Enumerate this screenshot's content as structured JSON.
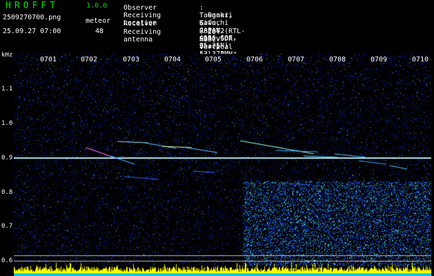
{
  "app": {
    "name": "HROFFT",
    "version": "1.0.0"
  },
  "file_name": "2509270700.png",
  "datetime": "25.09.27 07:00",
  "meteor": {
    "label": "meteor",
    "count": "48"
  },
  "info": [
    {
      "key": "Observer",
      "value": ": Takanori Kawachi"
    },
    {
      "key": "Receiving Location",
      "value": ": Ogaki, Gifu, JAPAN (136.60E, 35.35N)"
    },
    {
      "key": "Receiver",
      "value": ": R820T2(RTL-SDR) SDR-Sharp 53.372MHz"
    },
    {
      "key": "Receiving antenna",
      "value": ": 2el-HB9CV Vertical (el. E-W)"
    }
  ],
  "axis": {
    "y_unit": "kHz",
    "y_ticks": [
      "1.1",
      "1.0",
      "0.9",
      "0.8",
      "0.7",
      "0.6"
    ],
    "x_ticks": [
      "0701",
      "0702",
      "0703",
      "0704",
      "0705",
      "0706",
      "0707",
      "0708",
      "0709",
      "0710"
    ]
  },
  "colors": {
    "background": "#000000",
    "noise": "#0a1a9a",
    "carrier": "#a0ffff",
    "header_green": "#00e000",
    "level_bars": "#ffff00",
    "level_base": "#00c8ff"
  }
}
